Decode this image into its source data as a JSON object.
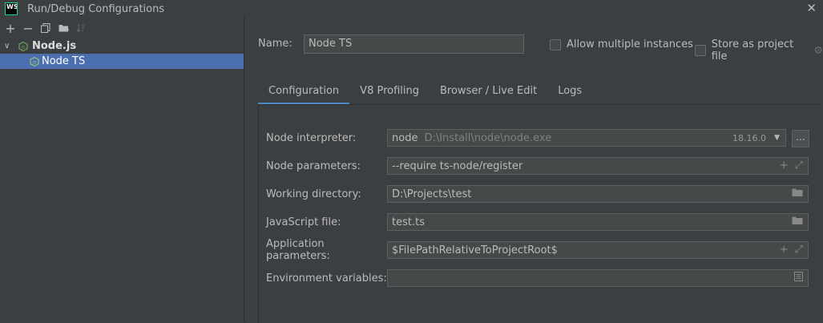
{
  "titlebar": {
    "logo_text": "WS",
    "title": "Run/Debug Configurations",
    "close": "✕"
  },
  "toolbar": {
    "add": "+",
    "remove": "−",
    "copy": "⧉",
    "folder": "▙",
    "sort": "↓a"
  },
  "tree": {
    "group_label": "Node.js",
    "item_label": "Node TS"
  },
  "name_label": "Name:",
  "name_value": "Node TS",
  "allow_multiple": "Allow multiple instances",
  "store_as_project": "Store as project file",
  "tabs": [
    "Configuration",
    "V8 Profiling",
    "Browser / Live Edit",
    "Logs"
  ],
  "fields": {
    "interpreter": {
      "label": "Node interpreter:",
      "name": "node",
      "path": "D:\\Install\\node\\node.exe",
      "version": "18.16.0"
    },
    "node_params": {
      "label": "Node parameters:",
      "value": "--require ts-node/register"
    },
    "working_dir": {
      "label": "Working directory:",
      "value": "D:\\Projects\\test"
    },
    "js_file": {
      "label": "JavaScript file:",
      "value": "test.ts"
    },
    "app_params": {
      "label": "Application parameters:",
      "value": "$FilePathRelativeToProjectRoot$"
    },
    "env_vars": {
      "label": "Environment variables:",
      "value": ""
    }
  },
  "dots_button": "...",
  "colors": {
    "accent": "#4a88c7",
    "selection": "#4b6eaf",
    "node_green": "#6ca15a"
  }
}
